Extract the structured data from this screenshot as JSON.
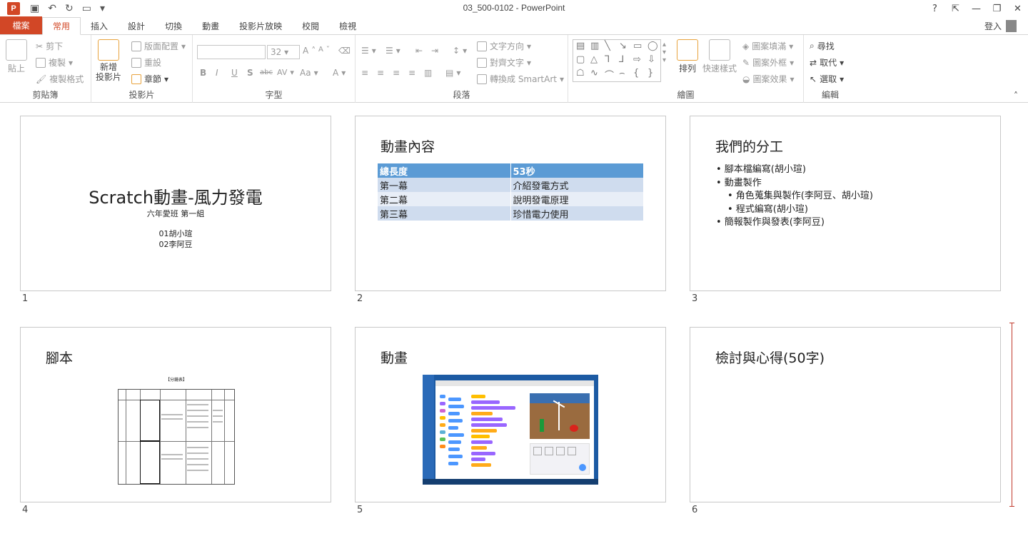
{
  "titlebar": {
    "app_icon": "P",
    "title": "03_500-0102 - PowerPoint",
    "help": "?",
    "ribbon_display": "⇱",
    "minimize": "—",
    "restore": "❐",
    "close": "✕"
  },
  "tabs": [
    {
      "label": "檔案"
    },
    {
      "label": "常用"
    },
    {
      "label": "插入"
    },
    {
      "label": "設計"
    },
    {
      "label": "切換"
    },
    {
      "label": "動畫"
    },
    {
      "label": "投影片放映"
    },
    {
      "label": "校閱"
    },
    {
      "label": "檢視"
    }
  ],
  "signin": "登入",
  "ribbon": {
    "clipboard": {
      "label": "剪貼簿",
      "paste": "貼上",
      "cut": "剪下",
      "copy": "複製",
      "format_painter": "複製格式"
    },
    "slides": {
      "label": "投影片",
      "new_slide_1": "新增",
      "new_slide_2": "投影片",
      "layout": "版面配置",
      "reset": "重設",
      "section": "章節"
    },
    "font": {
      "label": "字型",
      "size": "32",
      "bold": "B",
      "italic": "I",
      "underline": "U",
      "shadow": "S",
      "strike": "abc",
      "spacing": "AV",
      "case": "Aa",
      "color": "A",
      "grow": "A",
      "shrink": "A"
    },
    "paragraph": {
      "label": "段落",
      "text_direction": "文字方向",
      "align_text": "對齊文字",
      "smartart": "轉換成 SmartArt"
    },
    "drawing": {
      "label": "繪圖",
      "arrange": "排列",
      "quick_styles": "快速樣式",
      "fill": "圖案填滿",
      "outline": "圖案外框",
      "effects": "圖案效果"
    },
    "editing": {
      "label": "編輯",
      "find": "尋找",
      "replace": "取代",
      "select": "選取"
    }
  },
  "slides": [
    {
      "number": "1",
      "title": "Scratch動畫-風力發電",
      "subtitle": "六年愛班 第一組",
      "line1": "01胡小瑄",
      "line2": "02李阿豆"
    },
    {
      "number": "2",
      "title": "動畫內容",
      "table": [
        [
          "總長度",
          "53秒"
        ],
        [
          "第一幕",
          "介紹發電方式"
        ],
        [
          "第二幕",
          "說明發電原理"
        ],
        [
          "第三幕",
          "珍惜電力使用"
        ]
      ]
    },
    {
      "number": "3",
      "title": "我們的分工",
      "bullets": [
        "• 腳本檔編寫(胡小瑄)",
        "• 動畫製作",
        "• 角色蒐集與製作(李阿豆、胡小瑄)",
        "• 程式編寫(胡小瑄)",
        "• 簡報製作與發表(李阿豆)"
      ]
    },
    {
      "number": "4",
      "title": "腳本",
      "doc_heading": "【分鏡表】"
    },
    {
      "number": "5",
      "title": "動畫"
    },
    {
      "number": "6",
      "title": "檢討與心得(50字)"
    }
  ]
}
